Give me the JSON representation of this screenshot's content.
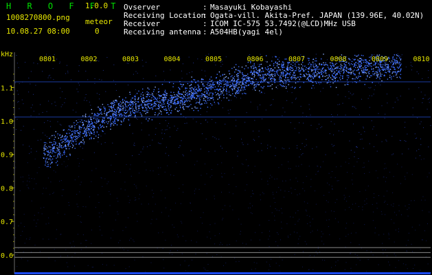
{
  "header": {
    "app_name": "H R O F F T",
    "version": "1.0.0",
    "file_name": "1008270800.png",
    "counter_label": "meteor",
    "datetime": "10.08.27 08:00",
    "counter_value": "0"
  },
  "info": [
    {
      "label": "Ovserver",
      "sep": ":",
      "value": "Masayuki Kobayashi"
    },
    {
      "label": "Receiving Location",
      "sep": ":",
      "value": "Ogata-vill. Akita-Pref. JAPAN (139.96E, 40.02N)"
    },
    {
      "label": "Receiver",
      "sep": ":",
      "value": "ICOM IC-575 53.7492(@LCD)MHz USB"
    },
    {
      "label": "Receiving antenna",
      "sep": ":",
      "value": "A504HB(yagi 4el)"
    }
  ],
  "colors": {
    "background": "#000000",
    "title": "#00e000",
    "header_text": "#e8e800",
    "info_text": "#ffffff",
    "signal": "#3a6cff",
    "ref_line_blue": "#1a3aa0",
    "ref_line_grey": "#8a8a8a"
  },
  "chart_data": {
    "type": "heatmap",
    "title": "",
    "ylabel": "kHz",
    "y_ticks": [
      "1.1",
      "1.0",
      "0.9",
      "0.8",
      "0.7",
      "0.6"
    ],
    "x_ticks": [
      "0801",
      "0802",
      "0803",
      "0804",
      "0805",
      "0806",
      "0807",
      "0808",
      "0809",
      "0810"
    ],
    "ylim": [
      0.58,
      1.17
    ],
    "xlim": [
      0,
      10
    ],
    "signal_trace": {
      "x": [
        0.0,
        0.5,
        1.0,
        1.5,
        2.0,
        2.5,
        3.0,
        3.5,
        4.0,
        4.5,
        5.0,
        5.5,
        6.0,
        6.5,
        7.0,
        7.5,
        8.0,
        8.5
      ],
      "y": [
        0.905,
        0.945,
        0.985,
        1.02,
        1.045,
        1.055,
        1.065,
        1.08,
        1.095,
        1.115,
        1.135,
        1.145,
        1.145,
        1.15,
        1.155,
        1.16,
        1.165,
        1.165
      ]
    },
    "reference_lines_khz": [
      1.117,
      1.012,
      0.622,
      0.607,
      0.593
    ]
  }
}
